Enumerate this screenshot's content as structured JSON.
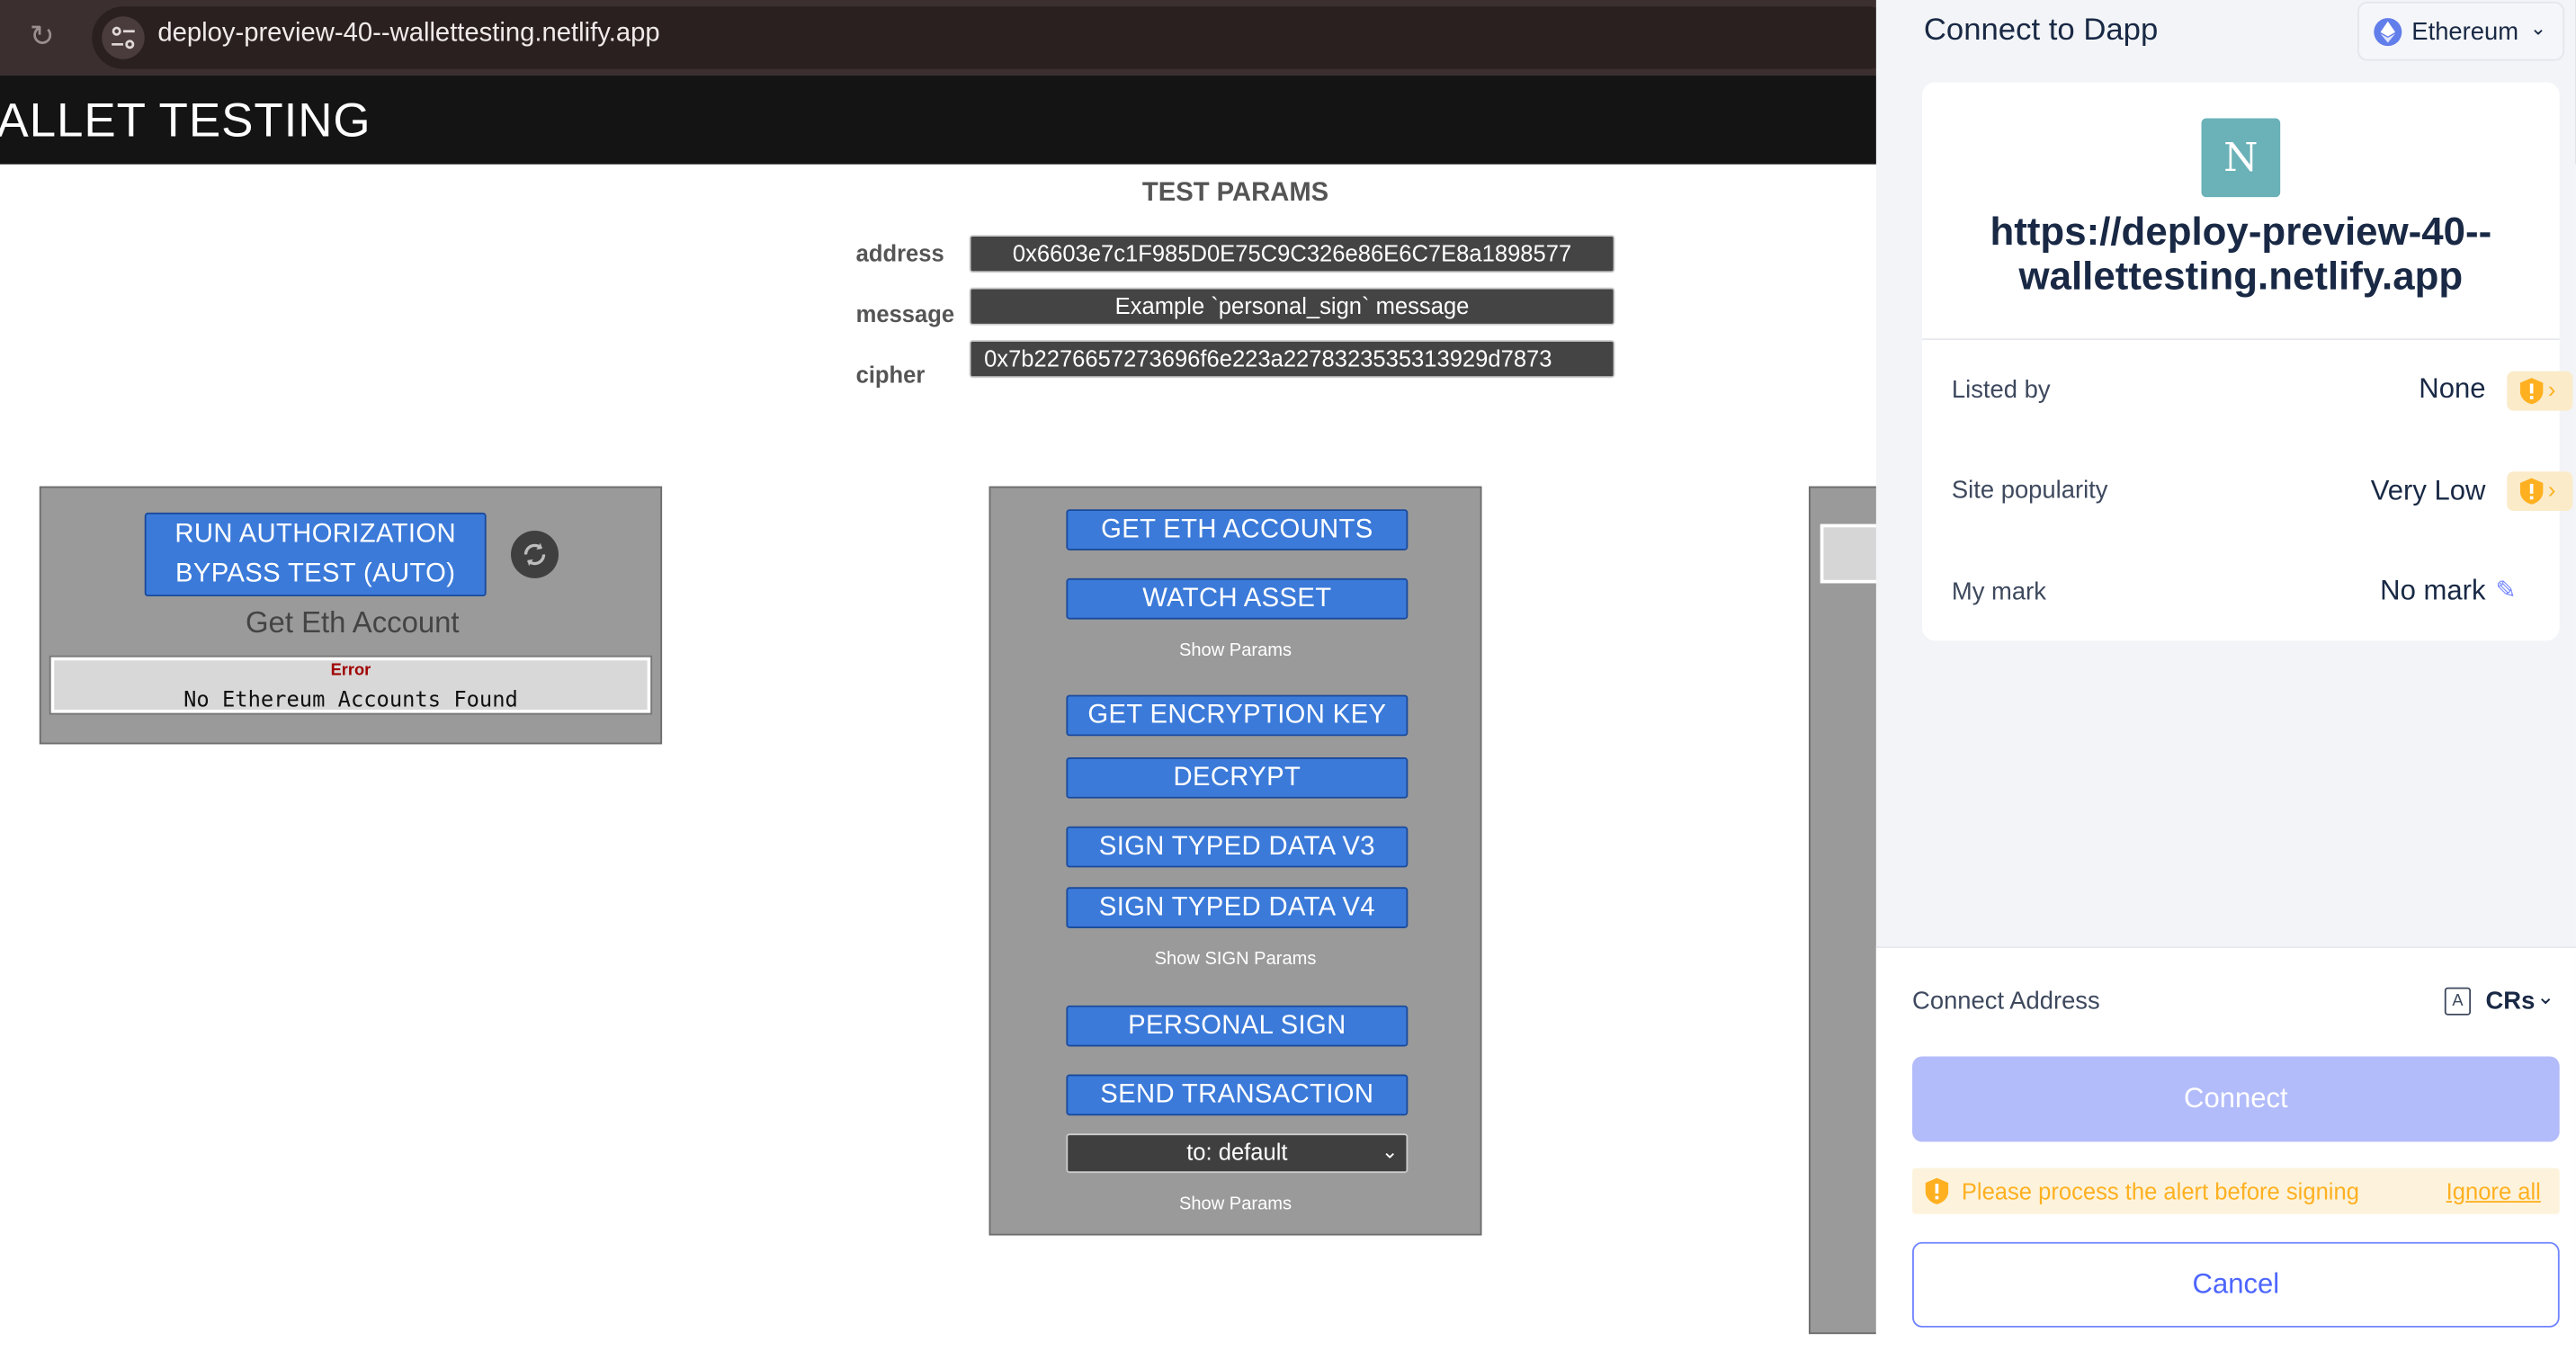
{
  "browser": {
    "url": "deploy-preview-40--wallettesting.netlify.app"
  },
  "header": {
    "title": "ALLET TESTING"
  },
  "params": {
    "title": "TEST PARAMS",
    "address_label": "address",
    "address_value": "0x6603e7c1F985D0E75C9C326e86E6C7E8a1898577",
    "message_label": "message",
    "message_value": "Example `personal_sign` message",
    "cipher_label": "cipher",
    "cipher_value": "0x7b2276657273696f6e223a2278323535313929d7873"
  },
  "left_panel": {
    "auth_button": "RUN AUTHORIZATION BYPASS TEST (AUTO)",
    "subhead": "Get Eth Account",
    "error_label": "Error",
    "error_message": "No Ethereum Accounts Found"
  },
  "center_panel": {
    "get_eth_accounts": "GET ETH ACCOUNTS",
    "watch_asset": "WATCH ASSET",
    "show_params_1": "Show Params",
    "get_encryption_key": "GET ENCRYPTION KEY",
    "decrypt": "DECRYPT",
    "sign_v3": "SIGN TYPED DATA V3",
    "sign_v4": "SIGN TYPED DATA V4",
    "show_sign_params": "Show SIGN Params",
    "personal_sign": "PERSONAL SIGN",
    "send_transaction": "SEND TRANSACTION",
    "to_select": "to: default",
    "show_params_2": "Show Params"
  },
  "dapp": {
    "title": "Connect to Dapp",
    "chain": "Ethereum",
    "site_logo_letter": "N",
    "site_origin": "https://deploy-preview-40--wallettesting.netlify.app",
    "listed_by_label": "Listed by",
    "listed_by_value": "None",
    "popularity_label": "Site popularity",
    "popularity_value": "Very Low",
    "mark_label": "My mark",
    "mark_value": "No mark",
    "connect_address_label": "Connect Address",
    "account_icon_letter": "A",
    "account_name": "CRs",
    "connect_button": "Connect",
    "alert_text": "Please process the alert before signing",
    "ignore_all": "Ignore all",
    "cancel_button": "Cancel"
  },
  "colors": {
    "primary_button": "#3b7ad9",
    "connect_disabled": "#b3bcfa",
    "warning": "#ffb020",
    "accent": "#7084ff"
  }
}
